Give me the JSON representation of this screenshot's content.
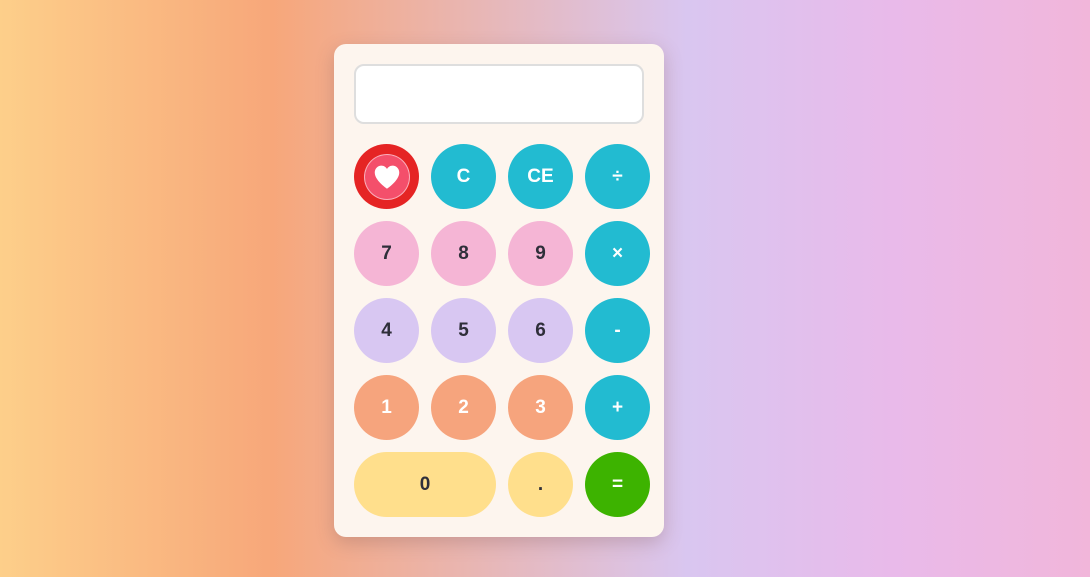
{
  "display": {
    "value": ""
  },
  "buttons": {
    "heart_icon": "heart-icon",
    "clear": "C",
    "clear_entry": "CE",
    "divide": "÷",
    "seven": "7",
    "eight": "8",
    "nine": "9",
    "multiply": "×",
    "four": "4",
    "five": "5",
    "six": "6",
    "subtract": "-",
    "one": "1",
    "two": "2",
    "three": "3",
    "add": "+",
    "zero": "0",
    "decimal": ".",
    "equals": "="
  },
  "colors": {
    "operator": "#22bbd1",
    "row_789": "#f5b5d5",
    "row_456": "#d8c7f2",
    "row_123": "#f6a47d",
    "row_0": "#ffdf8c",
    "equals": "#3db300",
    "heart_button": "#e52424"
  }
}
